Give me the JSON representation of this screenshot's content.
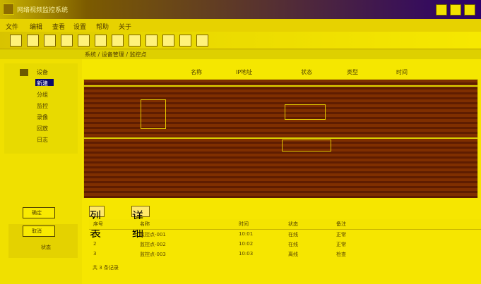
{
  "window": {
    "title": "网络视频监控系统"
  },
  "menu": {
    "items": [
      "文件",
      "编辑",
      "查看",
      "设置",
      "帮助",
      "关于"
    ]
  },
  "toolbar": {
    "buttons": [
      "新建",
      "打开",
      "保存",
      "删除",
      "刷新",
      "播放",
      "暂停",
      "停止",
      "设置",
      "帮助",
      "录像",
      "退出"
    ]
  },
  "address": {
    "path": "系统 / 设备管理 / 监控点"
  },
  "sidebar": {
    "items": [
      "设备",
      "新建",
      "分组",
      "监控",
      "录像",
      "回放",
      "日志"
    ],
    "selected": "新建"
  },
  "rightbar": {
    "headers": [
      "名称",
      "IP地址",
      "状态",
      "类型",
      "时间"
    ]
  },
  "bottom": {
    "tabs": [
      "列表",
      "详细"
    ],
    "headers": [
      "序号",
      "名称",
      "时间",
      "状态",
      "备注"
    ],
    "rows": [
      {
        "id": "1",
        "name": "监控点-001",
        "time": "10:01",
        "status": "在线",
        "note": "正常"
      },
      {
        "id": "2",
        "name": "监控点-002",
        "time": "10:02",
        "status": "在线",
        "note": "正常"
      },
      {
        "id": "3",
        "name": "监控点-003",
        "time": "10:03",
        "status": "离线",
        "note": "检查"
      }
    ],
    "status": "共 3 条记录"
  },
  "left_controls": {
    "box1": "确定",
    "box2": "取消",
    "caption": "状态"
  },
  "colors": {
    "background": "#f6e400",
    "canvas_dark": "#7f2f00",
    "selection": "#0b0b6b"
  }
}
